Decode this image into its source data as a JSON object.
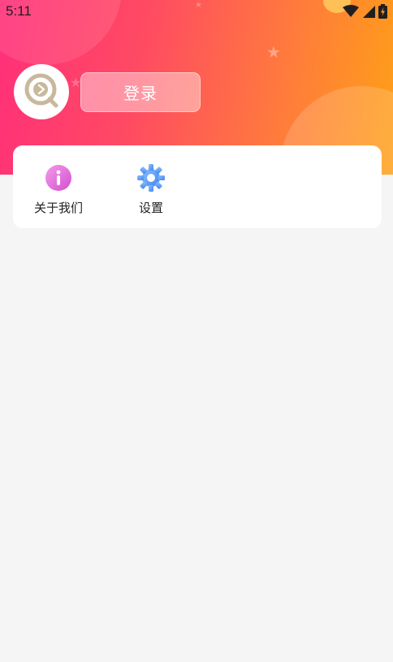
{
  "status_bar": {
    "time": "5:11",
    "icons": [
      "wifi-icon",
      "cellular-signal-icon",
      "battery-charging-icon"
    ]
  },
  "header": {
    "gradient_colors": [
      "#ff2f79",
      "#ff4a63",
      "#ff7a3d",
      "#ffa016"
    ],
    "avatar_icon": "app-logo-icon",
    "login_label": "登录"
  },
  "menu": {
    "items": [
      {
        "label": "关于我们",
        "icon": "info-icon",
        "color": "#e86ad9"
      },
      {
        "label": "设置",
        "icon": "gear-icon",
        "color": "#5b9cf2"
      }
    ]
  },
  "colors": {
    "page_background": "#f5f5f5",
    "card_background": "#ffffff",
    "avatar_logo": "#c8b89c"
  }
}
